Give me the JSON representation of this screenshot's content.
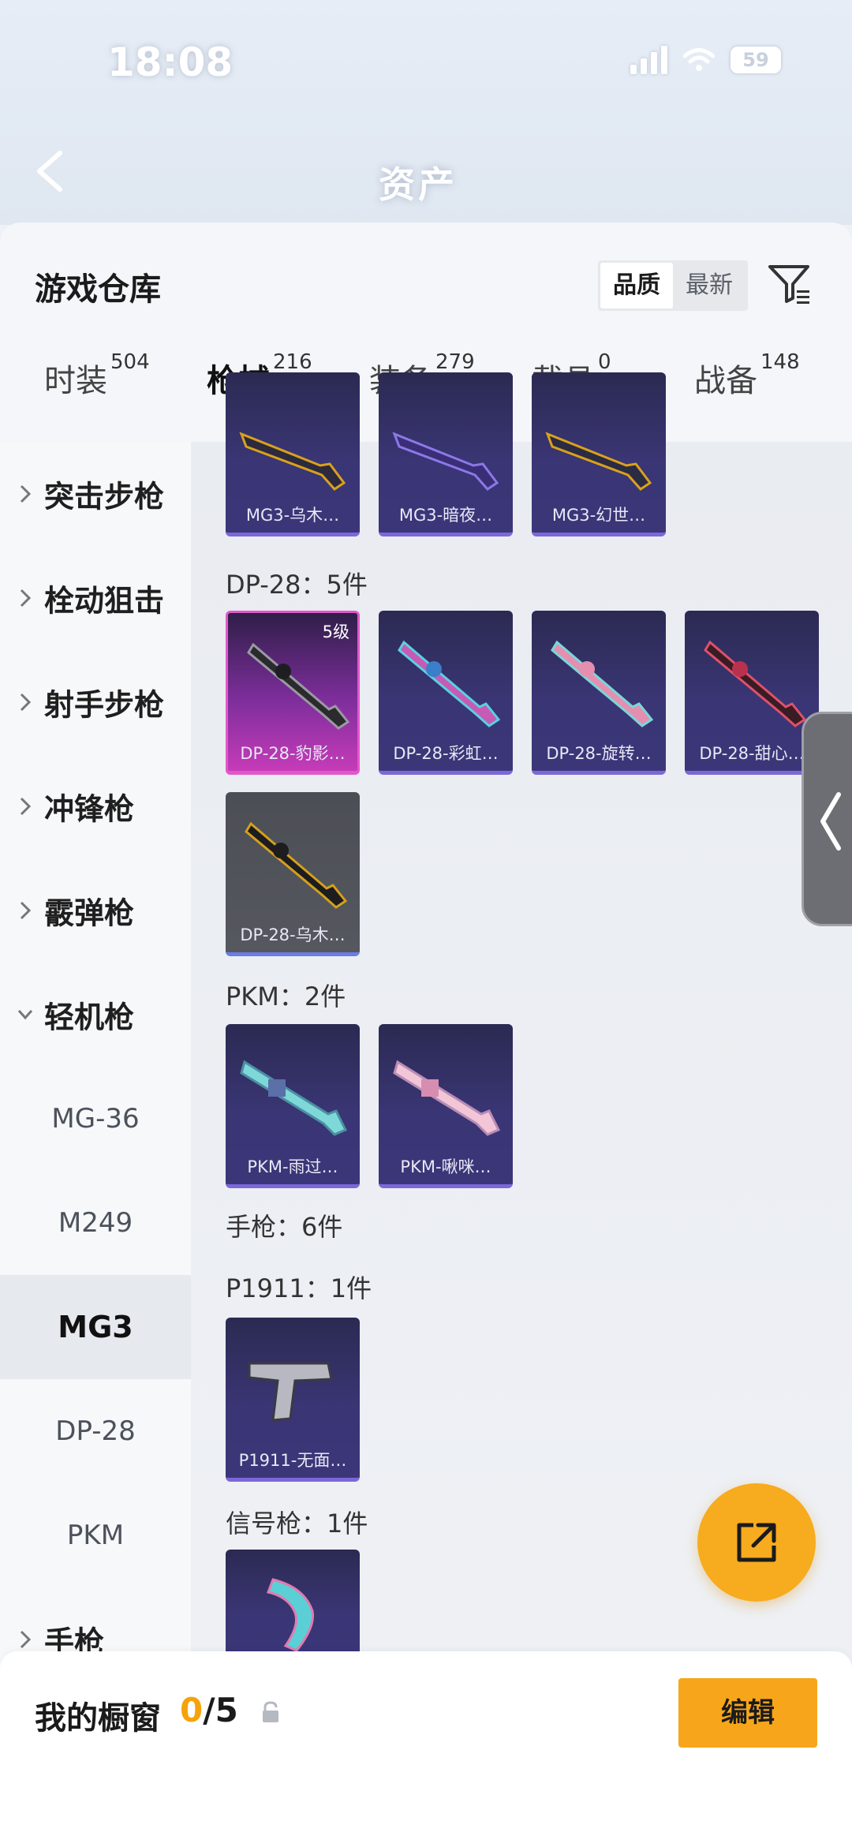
{
  "status_bar": {
    "time": "18:08",
    "battery": "59"
  },
  "nav": {
    "title": "资产"
  },
  "sheet": {
    "title": "游戏仓库",
    "sort_options": [
      "品质",
      "最新"
    ],
    "tabs": [
      {
        "label": "时装",
        "count": "504"
      },
      {
        "label": "枪械",
        "count": "216"
      },
      {
        "label": "装备",
        "count": "279"
      },
      {
        "label": "载具",
        "count": "0"
      },
      {
        "label": "战备",
        "count": "148"
      }
    ]
  },
  "categories": {
    "main": [
      "突击步枪",
      "栓动狙击",
      "射手步枪",
      "冲锋枪",
      "霰弹枪",
      "轻机枪"
    ],
    "lmg_sub": [
      "MG-36",
      "M249",
      "MG3",
      "DP-28",
      "PKM"
    ],
    "after": [
      "手枪"
    ]
  },
  "content": {
    "mg3_cards": [
      "MG3-乌木…",
      "MG3-暗夜…",
      "MG3-幻世…"
    ],
    "dp28_title": "DP-28：5件",
    "dp28_cards": [
      "DP-28-豹影…",
      "DP-28-彩虹…",
      "DP-28-旋转…",
      "DP-28-甜心…",
      "DP-28-乌木…"
    ],
    "dp28_level": "5级",
    "pkm_title": "PKM：2件",
    "pkm_cards": [
      "PKM-雨过…",
      "PKM-啾咪…"
    ],
    "pistol_title": "手枪：6件",
    "p1911_title": "P1911：1件",
    "p1911_cards": [
      "P1911-无面…"
    ],
    "flare_title": "信号枪：1件"
  },
  "bottom": {
    "shelf_label": "我的橱窗",
    "shelf_used": "0",
    "shelf_total": "/5",
    "edit_label": "编辑"
  },
  "colors": {
    "accent": "#f5a30c",
    "card_purple": "#3a3574",
    "card_pink": "#c63bb8"
  }
}
